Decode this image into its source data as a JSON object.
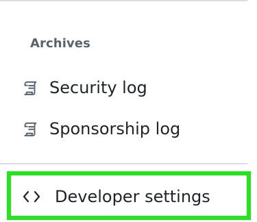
{
  "sidebar": {
    "section_heading": "Archives",
    "items": [
      {
        "label": "Security log",
        "icon": "log-icon"
      },
      {
        "label": "Sponsorship log",
        "icon": "log-icon"
      }
    ],
    "developer": {
      "label": "Developer settings",
      "icon": "code-icon"
    }
  },
  "colors": {
    "highlight": "#22e51c",
    "text": "#1f2328",
    "muted": "#59636e",
    "divider": "#d8dee4"
  }
}
